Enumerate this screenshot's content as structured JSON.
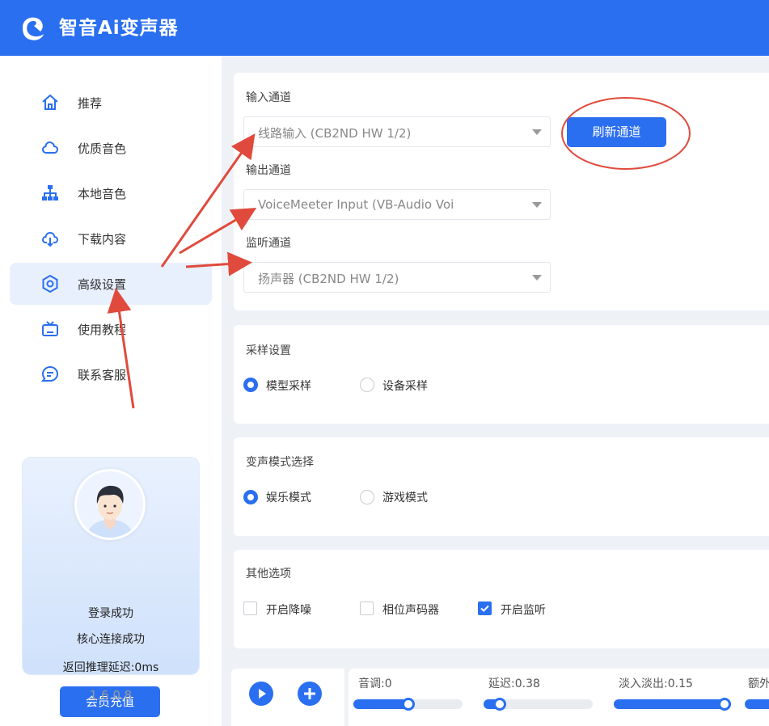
{
  "app": {
    "title": "智音Ai变声器"
  },
  "sidebar": {
    "items": [
      {
        "label": "推荐",
        "icon": "home-icon"
      },
      {
        "label": "优质音色",
        "icon": "cloud-icon"
      },
      {
        "label": "本地音色",
        "icon": "sitemap-icon"
      },
      {
        "label": "下载内容",
        "icon": "cloud-download-icon"
      },
      {
        "label": "高级设置",
        "icon": "settings-icon",
        "active": true
      },
      {
        "label": "使用教程",
        "icon": "tv-icon"
      },
      {
        "label": "联系客服",
        "icon": "chat-icon"
      }
    ],
    "profile": {
      "login_status": "登录成功",
      "core_status": "核心连接成功",
      "latency": "返回推理延迟:0ms",
      "vip_button": "会员充值"
    },
    "version": "1.6.0.8"
  },
  "channels": {
    "input_label": "输入通道",
    "input_value": "线路输入 (CB2ND HW 1/2)",
    "refresh_button": "刷新通道",
    "output_label": "输出通道",
    "output_value": "VoiceMeeter Input (VB-Audio Voi",
    "monitor_label": "监听通道",
    "monitor_value": "扬声器 (CB2ND HW 1/2)"
  },
  "sampling": {
    "title": "采样设置",
    "options": [
      "模型采样",
      "设备采样"
    ],
    "selected": "模型采样"
  },
  "mode": {
    "title": "变声模式选择",
    "options": [
      "娱乐模式",
      "游戏模式"
    ],
    "selected": "娱乐模式"
  },
  "other": {
    "title": "其他选项",
    "options": [
      {
        "label": "开启降噪",
        "checked": false
      },
      {
        "label": "相位声码器",
        "checked": false
      },
      {
        "label": "开启监听",
        "checked": true
      }
    ]
  },
  "sliders": [
    {
      "label": "音调:0",
      "value": 0
    },
    {
      "label": "延迟:0.38",
      "value": 0.38
    },
    {
      "label": "淡入淡出:0.15",
      "value": 0.15
    },
    {
      "label": "额外"
    }
  ],
  "slider_fill": [
    0.5,
    0.15,
    1.0,
    1.0
  ],
  "colors": {
    "accent": "#2a6ff0",
    "annotation": "#e04a3c"
  }
}
